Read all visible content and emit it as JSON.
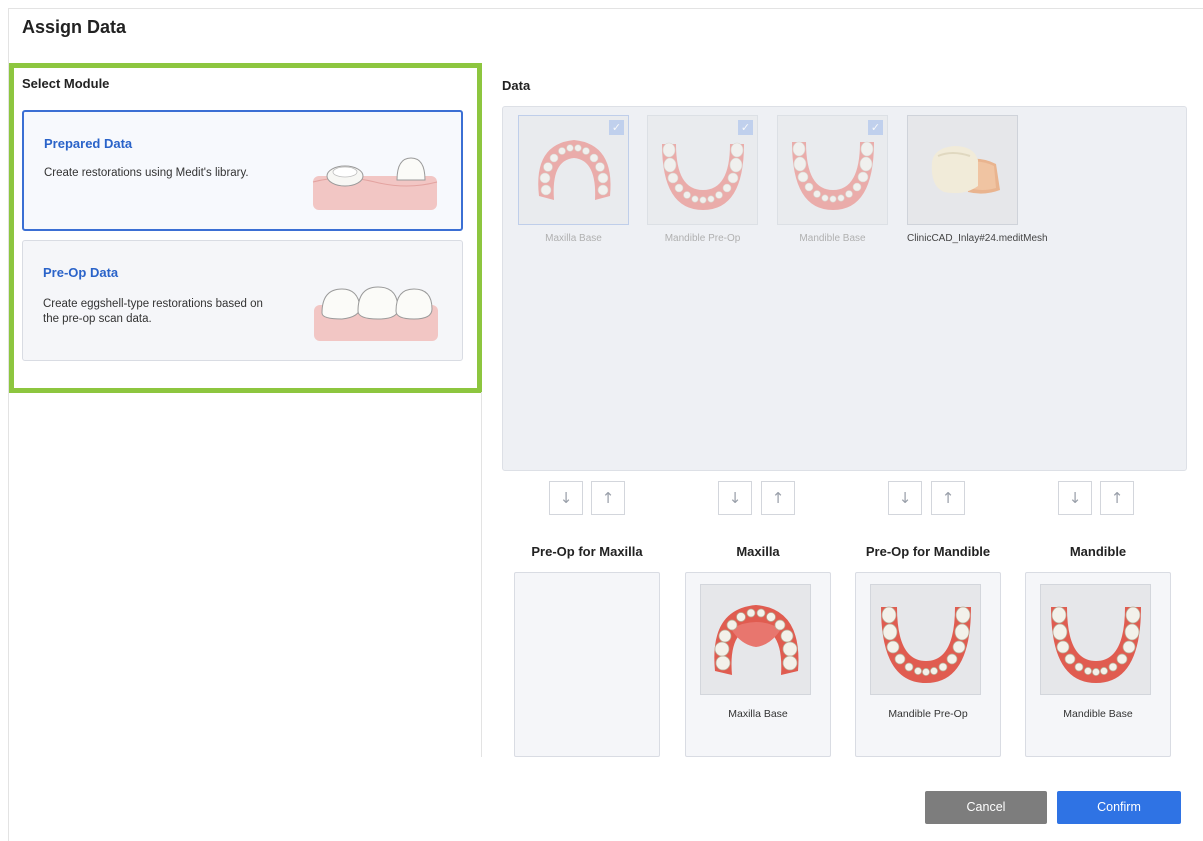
{
  "dialog": {
    "title": "Assign Data"
  },
  "module": {
    "heading": "Select Module",
    "cards": [
      {
        "title": "Prepared Data",
        "desc": "Create restorations using Medit's library.",
        "selected": true,
        "illustration": "prepared-teeth-illustration"
      },
      {
        "title": "Pre-Op Data",
        "desc": "Create eggshell-type restorations based on the pre-op scan data.",
        "selected": false,
        "illustration": "preop-teeth-illustration"
      }
    ]
  },
  "data": {
    "heading": "Data",
    "items": [
      {
        "label": "Maxilla Base",
        "assigned": true,
        "checked": true
      },
      {
        "label": "Mandible Pre-Op",
        "assigned": true,
        "checked": true
      },
      {
        "label": "Mandible Base",
        "assigned": true,
        "checked": true
      },
      {
        "label": "ClinicCAD_Inlay#24.meditMesh",
        "assigned": false,
        "checked": false
      }
    ]
  },
  "slots": [
    {
      "title": "Pre-Op for Maxilla",
      "label": ""
    },
    {
      "title": "Maxilla",
      "label": "Maxilla Base"
    },
    {
      "title": "Pre-Op for Mandible",
      "label": "Mandible Pre-Op"
    },
    {
      "title": "Mandible",
      "label": "Mandible Base"
    }
  ],
  "arrows": {
    "down": "↓",
    "up": "↑"
  },
  "footer": {
    "cancel": "Cancel",
    "confirm": "Confirm"
  },
  "colors": {
    "accent": "#2f73e4",
    "highlight": "#8dc63f",
    "gum": "#e8766e",
    "tooth": "#f3f1ea"
  }
}
